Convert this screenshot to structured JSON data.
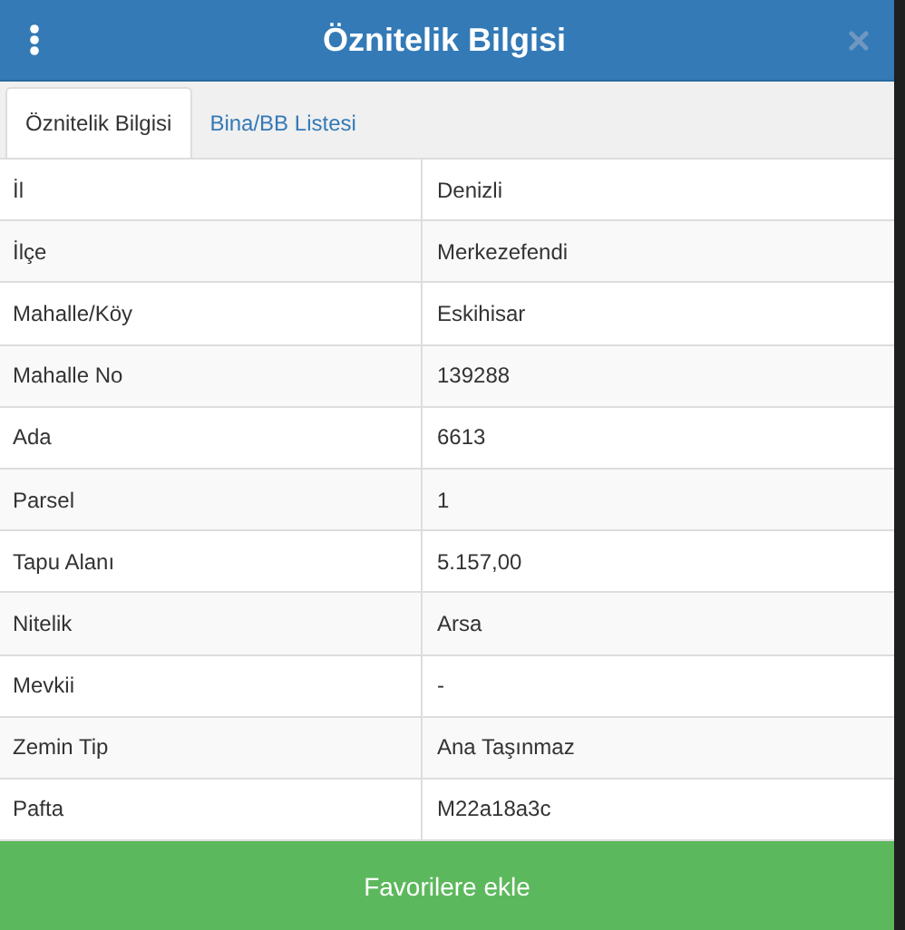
{
  "window": {
    "title": "Öznitelik Bilgisi"
  },
  "tabs": [
    {
      "label": "Öznitelik Bilgisi",
      "selected": true
    },
    {
      "label": "Bina/BB Listesi",
      "selected": false
    }
  ],
  "rows": [
    {
      "name": "İl",
      "value": "Denizli"
    },
    {
      "name": "İlçe",
      "value": "Merkezefendi"
    },
    {
      "name": "Mahalle/Köy",
      "value": "Eskihisar"
    },
    {
      "name": "Mahalle No",
      "value": "139288"
    },
    {
      "name": "Ada",
      "value": "6613"
    },
    {
      "name": "Parsel",
      "value": "1"
    },
    {
      "name": "Tapu Alanı",
      "value": "5.157,00"
    },
    {
      "name": "Nitelik",
      "value": "Arsa"
    },
    {
      "name": "Mevkii",
      "value": "-"
    },
    {
      "name": "Zemin Tip",
      "value": "Ana Taşınmaz"
    },
    {
      "name": "Pafta",
      "value": "M22a18a3c"
    }
  ],
  "action_button": "Favorilere ekle"
}
